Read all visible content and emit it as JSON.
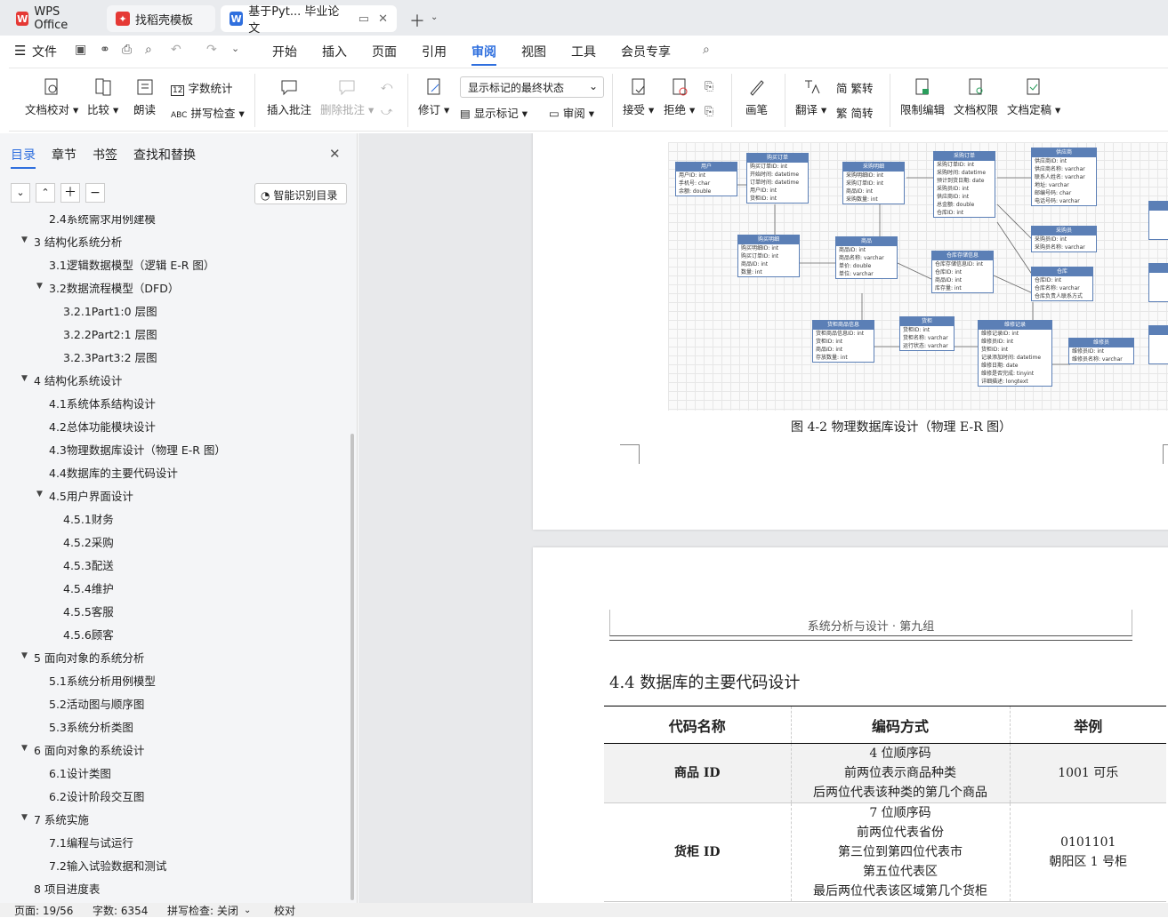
{
  "tabs": {
    "wps": "WPS Office",
    "template": "找稻壳模板",
    "doc": "基于Pyt... 毕业论文"
  },
  "menu": {
    "file": "文件",
    "items": [
      "开始",
      "插入",
      "页面",
      "引用",
      "审阅",
      "视图",
      "工具",
      "会员专享"
    ],
    "active": "审阅"
  },
  "ribbon": {
    "doc_check": "文档校对",
    "compare": "比较",
    "read": "朗读",
    "word_count": "字数统计",
    "spell": "拼写检查",
    "insert_comment": "插入批注",
    "delete_comment": "删除批注",
    "revise": "修订",
    "markup_state": "显示标记的最终状态",
    "show_markup": "显示标记",
    "review": "审阅",
    "accept": "接受",
    "reject": "拒绝",
    "pen": "画笔",
    "translate": "翻译",
    "to_trad": "繁转",
    "to_simp": "简转",
    "trad_icon": "简",
    "simp_icon": "繁",
    "restrict": "限制编辑",
    "doc_perm": "文档权限",
    "finalize": "文档定稿"
  },
  "sidebar": {
    "tabs": [
      "目录",
      "章节",
      "书签",
      "查找和替换"
    ],
    "smart_toc": "智能识别目录",
    "items": [
      {
        "label": "2.4系统需求用例建模",
        "level": 1
      },
      {
        "label": "3   结构化系统分析",
        "level": 0,
        "exp": true
      },
      {
        "label": "3.1逻辑数据模型（逻辑 E-R 图）",
        "level": 1
      },
      {
        "label": "3.2数据流程模型（DFD）",
        "level": 1,
        "exp": true
      },
      {
        "label": "3.2.1Part1:0 层图",
        "level": 2
      },
      {
        "label": "3.2.2Part2:1 层图",
        "level": 2
      },
      {
        "label": "3.2.3Part3:2 层图",
        "level": 2
      },
      {
        "label": "4   结构化系统设计",
        "level": 0,
        "exp": true
      },
      {
        "label": "4.1系统体系结构设计",
        "level": 1
      },
      {
        "label": "4.2总体功能模块设计",
        "level": 1
      },
      {
        "label": "4.3物理数据库设计（物理 E-R 图）",
        "level": 1
      },
      {
        "label": "4.4数据库的主要代码设计",
        "level": 1
      },
      {
        "label": "4.5用户界面设计",
        "level": 1,
        "exp": true
      },
      {
        "label": "4.5.1财务",
        "level": 2
      },
      {
        "label": "4.5.2采购",
        "level": 2
      },
      {
        "label": "4.5.3配送",
        "level": 2
      },
      {
        "label": "4.5.4维护",
        "level": 2
      },
      {
        "label": "4.5.5客服",
        "level": 2
      },
      {
        "label": "4.5.6顾客",
        "level": 2
      },
      {
        "label": "5   面向对象的系统分析",
        "level": 0,
        "exp": true
      },
      {
        "label": "5.1系统分析用例模型",
        "level": 1
      },
      {
        "label": "5.2活动图与顺序图",
        "level": 1
      },
      {
        "label": "5.3系统分析类图",
        "level": 1
      },
      {
        "label": "6   面向对象的系统设计",
        "level": 0,
        "exp": true
      },
      {
        "label": "6.1设计类图",
        "level": 1
      },
      {
        "label": "6.2设计阶段交互图",
        "level": 1
      },
      {
        "label": "7   系统实施",
        "level": 0,
        "exp": true
      },
      {
        "label": "7.1编程与试运行",
        "level": 1
      },
      {
        "label": "7.2输入试验数据和测试",
        "level": 1
      },
      {
        "label": "8   项目进度表",
        "level": 0
      }
    ]
  },
  "doc": {
    "figure_caption": "图 4-2  物理数据库设计（物理 E-R 图）",
    "header": "系统分析与设计 · 第九组",
    "section_title": "4.4  数据库的主要代码设计",
    "table": {
      "headers": [
        "代码名称",
        "编码方式",
        "举例"
      ],
      "rows": [
        {
          "name": "商品 ID",
          "method": [
            "4 位顺序码",
            "前两位表示商品种类",
            "后两位代表该种类的第几个商品"
          ],
          "example": [
            "1001 可乐"
          ]
        },
        {
          "name": "货柜 ID",
          "method": [
            "7 位顺序码",
            "前两位代表省份",
            "第三位到第四位代表市",
            "第五位代表区",
            "最后两位代表该区域第几个货柜"
          ],
          "example": [
            "0101101",
            "朝阳区 1 号柜"
          ]
        }
      ]
    },
    "er_entities": [
      {
        "title": "用户",
        "fields": [
          "用户ID: int",
          "手机号: char",
          "余额: double"
        ]
      },
      {
        "title": "购买订单",
        "fields": [
          "购买订单ID: int",
          "开始时间: datetime",
          "订单时间: datetime",
          "用户ID: int",
          "货柜ID: int"
        ]
      },
      {
        "title": "采购明细",
        "fields": [
          "采购明细ID: int",
          "采购订单ID: int",
          "商品ID: int",
          "采购数量: int"
        ]
      },
      {
        "title": "采购订单",
        "fields": [
          "采购订单ID: int",
          "采购时间: datetime",
          "预计到货日期: date",
          "采购员ID: int",
          "供应商ID: int",
          "总金额: double",
          "仓库ID: int"
        ]
      },
      {
        "title": "供应商",
        "fields": [
          "供应商ID: int",
          "供应商名称: varchar",
          "联系人姓名: varchar",
          "地址: varchar",
          "邮编号码: char",
          "电话号码: varchar"
        ]
      },
      {
        "title": "购买明细",
        "fields": [
          "购买明细ID: int",
          "购买订单ID: int",
          "商品ID: int",
          "数量: int"
        ]
      },
      {
        "title": "商品",
        "fields": [
          "商品ID: int",
          "商品名称: varchar",
          "单价: double",
          "单位: varchar"
        ]
      },
      {
        "title": "仓库存储信息",
        "fields": [
          "仓库存储信息ID: int",
          "仓库ID: int",
          "商品ID: int",
          "库存量: int"
        ]
      },
      {
        "title": "采购员",
        "fields": [
          "采购员ID: int",
          "采购员名称: varchar"
        ]
      },
      {
        "title": "仓库",
        "fields": [
          "仓库ID: int",
          "仓库名称: varchar",
          "仓库负责人联系方式"
        ]
      },
      {
        "title": "货柜商品信息",
        "fields": [
          "货柜商品信息ID: int",
          "货柜ID: int",
          "商品ID: int",
          "存放数量: int"
        ]
      },
      {
        "title": "货柜",
        "fields": [
          "货柜ID: int",
          "货柜名称: varchar",
          "运行状态: varchar"
        ]
      },
      {
        "title": "维修记录",
        "fields": [
          "维修记录ID: int",
          "维修员ID: int",
          "货柜ID: int",
          "记录添加时间: datetime",
          "维修日期: date",
          "维修是否完成: tinyint",
          "详细描述: longtext"
        ]
      },
      {
        "title": "维修员",
        "fields": [
          "维修员ID: int",
          "维修员名称: varchar"
        ]
      }
    ]
  },
  "status": {
    "page": "页面: 19/56",
    "words": "字数: 6354",
    "spell": "拼写检查: 关闭",
    "proof": "校对"
  }
}
